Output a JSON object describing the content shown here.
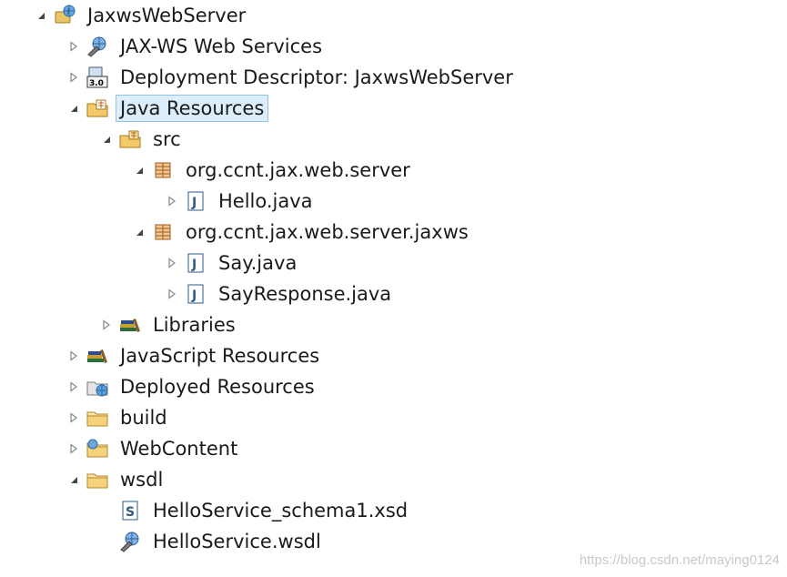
{
  "tree": {
    "items": [
      {
        "id": "project",
        "label": "JaxwsWebServer",
        "icon": "web-project-icon",
        "expanded": true,
        "hasChildren": true
      },
      {
        "id": "jaxws-services",
        "label": "JAX-WS Web Services",
        "icon": "web-services-icon",
        "expanded": false,
        "hasChildren": true
      },
      {
        "id": "deployment-descriptor",
        "label": "Deployment Descriptor: JaxwsWebServer",
        "icon": "deployment-descriptor-icon",
        "expanded": false,
        "hasChildren": true
      },
      {
        "id": "java-resources",
        "label": "Java Resources",
        "icon": "java-resources-icon",
        "expanded": true,
        "hasChildren": true,
        "selected": true
      },
      {
        "id": "src",
        "label": "src",
        "icon": "source-folder-icon",
        "expanded": true,
        "hasChildren": true
      },
      {
        "id": "pkg-server",
        "label": "org.ccnt.jax.web.server",
        "icon": "package-icon",
        "expanded": true,
        "hasChildren": true
      },
      {
        "id": "hello-java",
        "label": "Hello.java",
        "icon": "java-file-icon",
        "expanded": false,
        "hasChildren": true
      },
      {
        "id": "pkg-jaxws",
        "label": "org.ccnt.jax.web.server.jaxws",
        "icon": "package-icon",
        "expanded": true,
        "hasChildren": true
      },
      {
        "id": "say-java",
        "label": "Say.java",
        "icon": "java-file-icon",
        "expanded": false,
        "hasChildren": true
      },
      {
        "id": "sayresponse-java",
        "label": "SayResponse.java",
        "icon": "java-file-icon",
        "expanded": false,
        "hasChildren": true
      },
      {
        "id": "libraries",
        "label": "Libraries",
        "icon": "libraries-icon",
        "expanded": false,
        "hasChildren": true
      },
      {
        "id": "js-resources",
        "label": "JavaScript Resources",
        "icon": "libraries-icon",
        "expanded": false,
        "hasChildren": true
      },
      {
        "id": "deployed-resources",
        "label": "Deployed Resources",
        "icon": "deployed-resources-icon",
        "expanded": false,
        "hasChildren": true
      },
      {
        "id": "build",
        "label": "build",
        "icon": "folder-icon",
        "expanded": false,
        "hasChildren": true
      },
      {
        "id": "webcontent",
        "label": "WebContent",
        "icon": "web-folder-icon",
        "expanded": false,
        "hasChildren": true
      },
      {
        "id": "wsdl",
        "label": "wsdl",
        "icon": "folder-icon",
        "expanded": true,
        "hasChildren": true
      },
      {
        "id": "schema-xsd",
        "label": "HelloService_schema1.xsd",
        "icon": "xsd-file-icon",
        "expanded": false,
        "hasChildren": false
      },
      {
        "id": "hello-wsdl",
        "label": "HelloService.wsdl",
        "icon": "wsdl-file-icon",
        "expanded": false,
        "hasChildren": false
      }
    ]
  },
  "watermark": "https://blog.csdn.net/maying0124"
}
